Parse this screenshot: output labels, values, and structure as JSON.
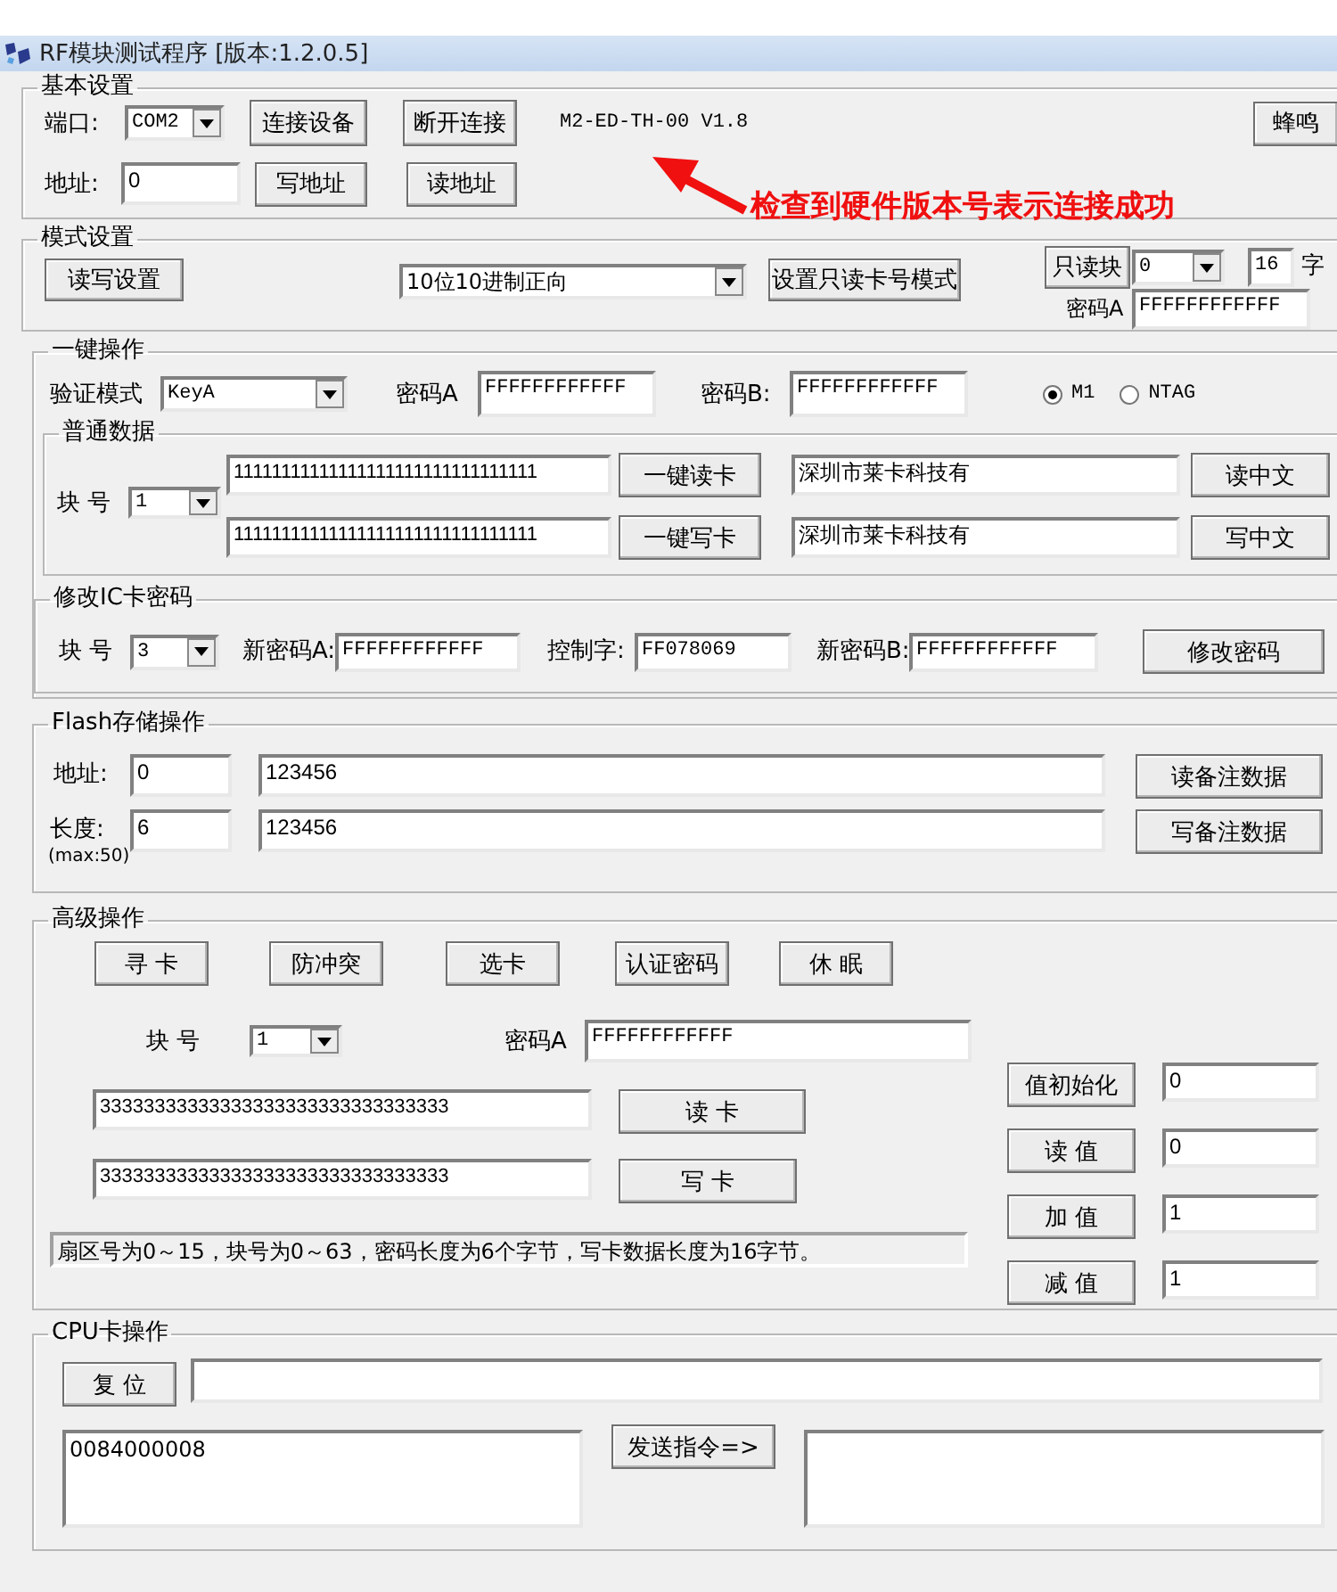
{
  "window": {
    "title": "RF模块测试程序 [版本:1.2.0.5]"
  },
  "basic": {
    "title": "基本设置",
    "port_label": "端口:",
    "port": "COM2",
    "connect": "连接设备",
    "disconnect": "断开连接",
    "version": "M2-ED-TH-00 V1.8",
    "beep": "蜂鸣",
    "address_label": "地址:",
    "address": "0",
    "write_address": "写地址",
    "read_address": "读地址"
  },
  "annotation": {
    "text": "检查到硬件版本号表示连接成功"
  },
  "mode": {
    "title": "模式设置",
    "rw_settings": "读写设置",
    "format": "10位10进制正向",
    "set_mode": "设置只读卡号模式",
    "readonly_block": "只读块",
    "block": "0",
    "bytes": "16",
    "bytes_unit": "字",
    "password_label": "密码A",
    "password": "FFFFFFFFFFFF"
  },
  "one_key": {
    "title": "一键操作",
    "auth_label": "验证模式",
    "auth_mode": "KeyA",
    "key_a_label": "密码A",
    "key_a": "FFFFFFFFFFFF",
    "key_b_label": "密码B:",
    "key_b": "FFFFFFFFFFFF",
    "card_types": [
      {
        "label": "M1",
        "selected": true
      },
      {
        "label": "NTAG",
        "selected": false
      }
    ],
    "normal": {
      "title": "普通数据",
      "block_label": "块 号",
      "block": "1",
      "rows": [
        {
          "data": "11111111111111111111111111111111",
          "action": "一键读卡",
          "text": "深圳市莱卡科技有",
          "text_action": "读中文"
        },
        {
          "data": "11111111111111111111111111111111",
          "action": "一键写卡",
          "text": "深圳市莱卡科技有",
          "text_action": "写中文"
        }
      ]
    },
    "change_key": {
      "title": "修改IC卡密码",
      "block_label": "块 号",
      "block": "3",
      "new_key_a_label": "新密码A:",
      "new_key_a": "FFFFFFFFFFFF",
      "access_label": "控制字:",
      "access": "FF078069",
      "new_key_b_label": "新密码B:",
      "new_key_b": "FFFFFFFFFFFF",
      "submit": "修改密码"
    }
  },
  "flash": {
    "title": "Flash存储操作",
    "rows": [
      {
        "label": "地址:",
        "value": "0",
        "data": "123456",
        "action": "读备注数据"
      },
      {
        "label": "长度:",
        "hint": "(max:50)",
        "value": "6",
        "data": "123456",
        "action": "写备注数据"
      }
    ]
  },
  "advanced": {
    "title": "高级操作",
    "commands": [
      "寻 卡",
      "防冲突",
      "选卡",
      "认证密码",
      "休 眠"
    ],
    "block_label": "块 号",
    "block": "1",
    "key_label": "密码A",
    "key": "FFFFFFFFFFFF",
    "rows": [
      {
        "data": "33333333333333333333333333333333",
        "action": "读 卡"
      },
      {
        "data": "33333333333333333333333333333333",
        "action": "写 卡"
      }
    ],
    "note": "扇区号为0～15，块号为0～63，密码长度为6个字节，写卡数据长度为16字节。",
    "values": [
      {
        "action": "值初始化",
        "value": "0"
      },
      {
        "action": "读 值",
        "value": "0"
      },
      {
        "action": "加 值",
        "value": "1"
      },
      {
        "action": "减 值",
        "value": "1"
      }
    ]
  },
  "cpu": {
    "title": "CPU卡操作",
    "reset": "复 位",
    "command": "0084000008",
    "send": "发送指令=>"
  }
}
